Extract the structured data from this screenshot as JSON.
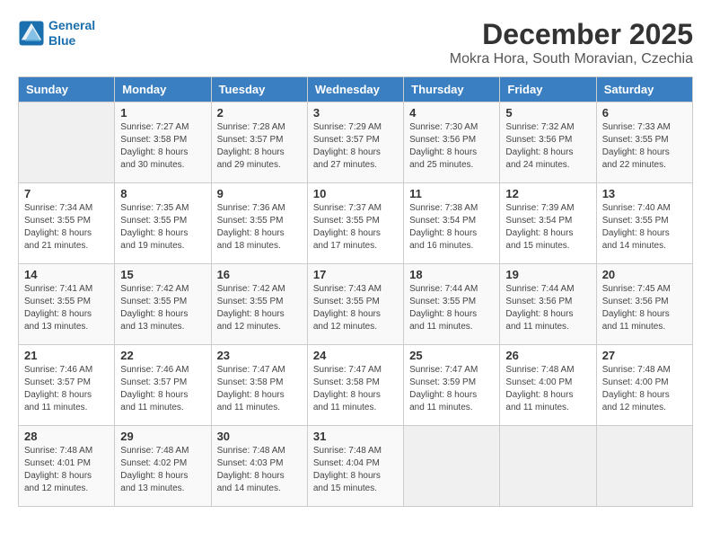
{
  "header": {
    "logo_line1": "General",
    "logo_line2": "Blue",
    "month": "December 2025",
    "location": "Mokra Hora, South Moravian, Czechia"
  },
  "days_of_week": [
    "Sunday",
    "Monday",
    "Tuesday",
    "Wednesday",
    "Thursday",
    "Friday",
    "Saturday"
  ],
  "weeks": [
    [
      {
        "num": "",
        "empty": true
      },
      {
        "num": "1",
        "sunrise": "7:27 AM",
        "sunset": "3:58 PM",
        "daylight": "8 hours and 30 minutes."
      },
      {
        "num": "2",
        "sunrise": "7:28 AM",
        "sunset": "3:57 PM",
        "daylight": "8 hours and 29 minutes."
      },
      {
        "num": "3",
        "sunrise": "7:29 AM",
        "sunset": "3:57 PM",
        "daylight": "8 hours and 27 minutes."
      },
      {
        "num": "4",
        "sunrise": "7:30 AM",
        "sunset": "3:56 PM",
        "daylight": "8 hours and 25 minutes."
      },
      {
        "num": "5",
        "sunrise": "7:32 AM",
        "sunset": "3:56 PM",
        "daylight": "8 hours and 24 minutes."
      },
      {
        "num": "6",
        "sunrise": "7:33 AM",
        "sunset": "3:55 PM",
        "daylight": "8 hours and 22 minutes."
      }
    ],
    [
      {
        "num": "7",
        "sunrise": "7:34 AM",
        "sunset": "3:55 PM",
        "daylight": "8 hours and 21 minutes."
      },
      {
        "num": "8",
        "sunrise": "7:35 AM",
        "sunset": "3:55 PM",
        "daylight": "8 hours and 19 minutes."
      },
      {
        "num": "9",
        "sunrise": "7:36 AM",
        "sunset": "3:55 PM",
        "daylight": "8 hours and 18 minutes."
      },
      {
        "num": "10",
        "sunrise": "7:37 AM",
        "sunset": "3:55 PM",
        "daylight": "8 hours and 17 minutes."
      },
      {
        "num": "11",
        "sunrise": "7:38 AM",
        "sunset": "3:54 PM",
        "daylight": "8 hours and 16 minutes."
      },
      {
        "num": "12",
        "sunrise": "7:39 AM",
        "sunset": "3:54 PM",
        "daylight": "8 hours and 15 minutes."
      },
      {
        "num": "13",
        "sunrise": "7:40 AM",
        "sunset": "3:55 PM",
        "daylight": "8 hours and 14 minutes."
      }
    ],
    [
      {
        "num": "14",
        "sunrise": "7:41 AM",
        "sunset": "3:55 PM",
        "daylight": "8 hours and 13 minutes."
      },
      {
        "num": "15",
        "sunrise": "7:42 AM",
        "sunset": "3:55 PM",
        "daylight": "8 hours and 13 minutes."
      },
      {
        "num": "16",
        "sunrise": "7:42 AM",
        "sunset": "3:55 PM",
        "daylight": "8 hours and 12 minutes."
      },
      {
        "num": "17",
        "sunrise": "7:43 AM",
        "sunset": "3:55 PM",
        "daylight": "8 hours and 12 minutes."
      },
      {
        "num": "18",
        "sunrise": "7:44 AM",
        "sunset": "3:55 PM",
        "daylight": "8 hours and 11 minutes."
      },
      {
        "num": "19",
        "sunrise": "7:44 AM",
        "sunset": "3:56 PM",
        "daylight": "8 hours and 11 minutes."
      },
      {
        "num": "20",
        "sunrise": "7:45 AM",
        "sunset": "3:56 PM",
        "daylight": "8 hours and 11 minutes."
      }
    ],
    [
      {
        "num": "21",
        "sunrise": "7:46 AM",
        "sunset": "3:57 PM",
        "daylight": "8 hours and 11 minutes."
      },
      {
        "num": "22",
        "sunrise": "7:46 AM",
        "sunset": "3:57 PM",
        "daylight": "8 hours and 11 minutes."
      },
      {
        "num": "23",
        "sunrise": "7:47 AM",
        "sunset": "3:58 PM",
        "daylight": "8 hours and 11 minutes."
      },
      {
        "num": "24",
        "sunrise": "7:47 AM",
        "sunset": "3:58 PM",
        "daylight": "8 hours and 11 minutes."
      },
      {
        "num": "25",
        "sunrise": "7:47 AM",
        "sunset": "3:59 PM",
        "daylight": "8 hours and 11 minutes."
      },
      {
        "num": "26",
        "sunrise": "7:48 AM",
        "sunset": "4:00 PM",
        "daylight": "8 hours and 11 minutes."
      },
      {
        "num": "27",
        "sunrise": "7:48 AM",
        "sunset": "4:00 PM",
        "daylight": "8 hours and 12 minutes."
      }
    ],
    [
      {
        "num": "28",
        "sunrise": "7:48 AM",
        "sunset": "4:01 PM",
        "daylight": "8 hours and 12 minutes."
      },
      {
        "num": "29",
        "sunrise": "7:48 AM",
        "sunset": "4:02 PM",
        "daylight": "8 hours and 13 minutes."
      },
      {
        "num": "30",
        "sunrise": "7:48 AM",
        "sunset": "4:03 PM",
        "daylight": "8 hours and 14 minutes."
      },
      {
        "num": "31",
        "sunrise": "7:48 AM",
        "sunset": "4:04 PM",
        "daylight": "8 hours and 15 minutes."
      },
      {
        "num": "",
        "empty": true
      },
      {
        "num": "",
        "empty": true
      },
      {
        "num": "",
        "empty": true
      }
    ]
  ]
}
